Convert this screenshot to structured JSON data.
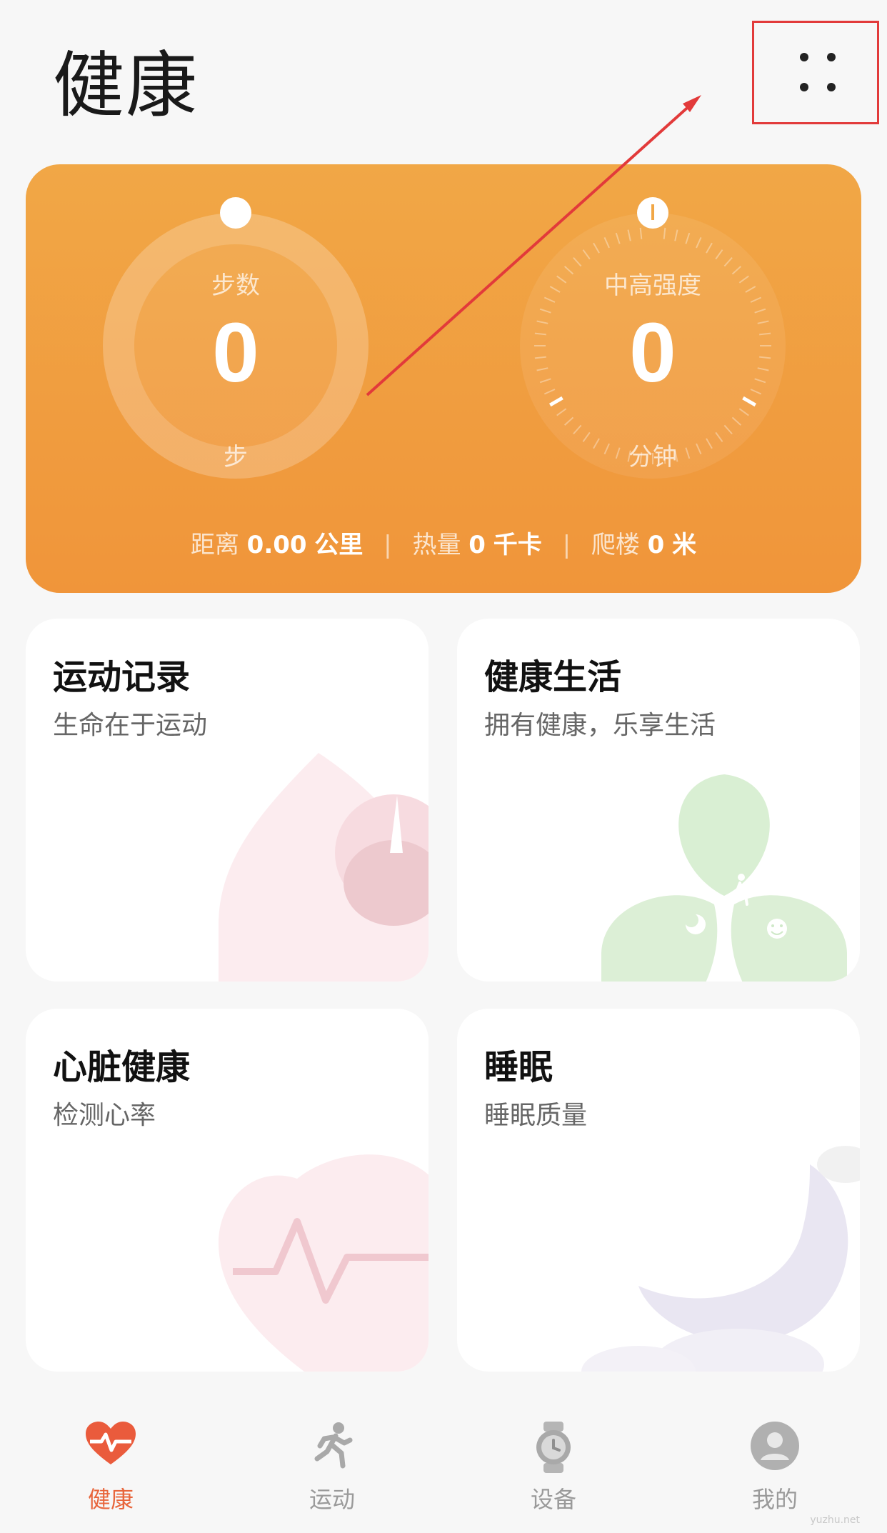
{
  "header": {
    "title": "健康"
  },
  "activity": {
    "steps": {
      "label": "步数",
      "value": "0",
      "unit": "步",
      "progress": 0
    },
    "intensity": {
      "label": "中高强度",
      "value": "0",
      "unit": "分钟",
      "progress": 0
    },
    "distance": {
      "label": "距离",
      "value": "0.00",
      "unit": "公里"
    },
    "calories": {
      "label": "热量",
      "value": "0",
      "unit": "千卡"
    },
    "floors": {
      "label": "爬楼",
      "value": "0",
      "unit": "米"
    },
    "separator": "|"
  },
  "tiles": [
    {
      "title": "运动记录",
      "subtitle": "生命在于运动",
      "icon": "flame-stopwatch-icon"
    },
    {
      "title": "健康生活",
      "subtitle": "拥有健康，乐享生活",
      "icon": "clover-lifestyle-icon"
    },
    {
      "title": "心脏健康",
      "subtitle": "检测心率",
      "icon": "heart-pulse-icon"
    },
    {
      "title": "睡眠",
      "subtitle": "睡眠质量",
      "icon": "moon-cloud-icon"
    }
  ],
  "bottom_nav": [
    {
      "label": "健康",
      "icon": "heart-pulse-icon",
      "active": true
    },
    {
      "label": "运动",
      "icon": "running-icon",
      "active": false
    },
    {
      "label": "设备",
      "icon": "watch-icon",
      "active": false
    },
    {
      "label": "我的",
      "icon": "avatar-icon",
      "active": false
    }
  ],
  "colors": {
    "accent": "#e8663c",
    "card_orange": "#f1a746",
    "annotation_red": "#e23a3a"
  },
  "watermark": "yuzhu.net"
}
